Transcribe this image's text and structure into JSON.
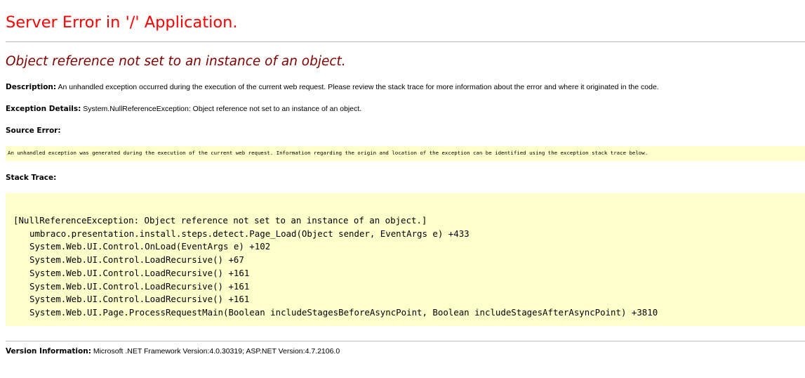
{
  "error_title": "Server Error in '/' Application.",
  "error_message": "Object reference not set to an instance of an object.",
  "description": {
    "label": "Description:",
    "text": "An unhandled exception occurred during the execution of the current web request. Please review the stack trace for more information about the error and where it originated in the code."
  },
  "exception_details": {
    "label": "Exception Details:",
    "text": "System.NullReferenceException: Object reference not set to an instance of an object."
  },
  "source_error": {
    "label": "Source Error:",
    "text": "An unhandled exception was generated during the execution of the current web request. Information regarding the origin and location of the exception can be identified using the exception stack trace below."
  },
  "stack_trace": {
    "label": "Stack Trace:",
    "header": "[NullReferenceException: Object reference not set to an instance of an object.]",
    "frames": [
      "umbraco.presentation.install.steps.detect.Page_Load(Object sender, EventArgs e) +433",
      "System.Web.UI.Control.OnLoad(EventArgs e) +102",
      "System.Web.UI.Control.LoadRecursive() +67",
      "System.Web.UI.Control.LoadRecursive() +161",
      "System.Web.UI.Control.LoadRecursive() +161",
      "System.Web.UI.Control.LoadRecursive() +161",
      "System.Web.UI.Page.ProcessRequestMain(Boolean includeStagesBeforeAsyncPoint, Boolean includeStagesAfterAsyncPoint) +3810"
    ]
  },
  "version_info": {
    "label": "Version Information:",
    "text": "Microsoft .NET Framework Version:4.0.30319; ASP.NET Version:4.7.2106.0"
  },
  "colors": {
    "title": "#ff0000",
    "message": "#800000",
    "code_background": "#ffffcc",
    "rule": "#c0c0c0"
  }
}
